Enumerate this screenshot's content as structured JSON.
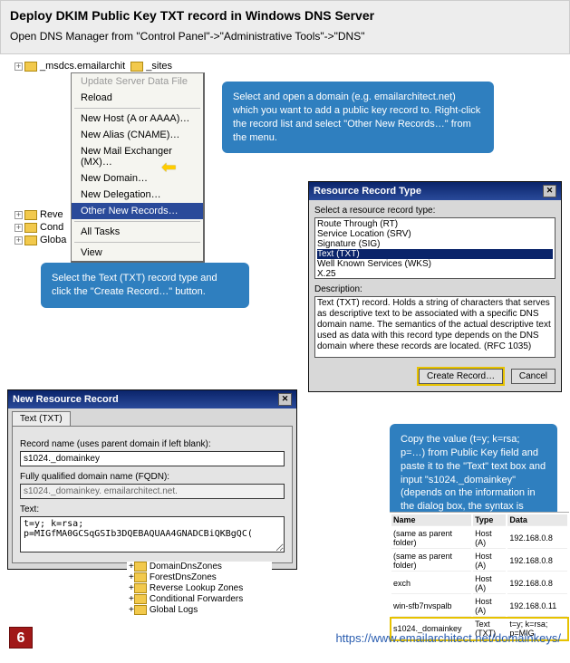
{
  "header": {
    "title": "Deploy DKIM Public Key TXT record in Windows DNS Server",
    "subtitle": "Open DNS Manager from \"Control Panel\"->\"Administrative Tools\"->\"DNS\""
  },
  "tree": {
    "row0": "_msdcs.emailarchit",
    "row0b": "_sites",
    "row5": "Reve",
    "row6": "Cond",
    "row7": "Globa"
  },
  "contextMenu": {
    "disabled": "Update Server Data File",
    "reload": "Reload",
    "newHost": "New Host (A or AAAA)…",
    "newAlias": "New Alias (CNAME)…",
    "newMx": "New Mail Exchanger (MX)…",
    "newDomain": "New Domain…",
    "newDeleg": "New Delegation…",
    "otherNew": "Other New Records…",
    "allTasks": "All Tasks",
    "view": "View"
  },
  "callouts": {
    "c1": "Select and open a domain (e.g. emailarchitect.net) which you want to add a public key record to. Right-click the record list and select \"Other New Records…\" from the menu.",
    "c2": "Select the Text (TXT) record type and click the \"Create Record…\" button.",
    "c3": "Copy the value (t=y; k=rsa; p=…) from Public Key field and paste it to the \"Text\" text box and input \"s1024._domainkey\" (depends on the information in the dialog box, the syntax is [selector]._domainkey) in Record Name. Click the OK button."
  },
  "rrtDialog": {
    "title": "Resource Record Type",
    "selectLabel": "Select a resource record type:",
    "items": [
      "Route Through (RT)",
      "Service Location (SRV)",
      "Signature (SIG)",
      "Text (TXT)",
      "Well Known Services (WKS)",
      "X.25"
    ],
    "descLabel": "Description:",
    "descText": "Text (TXT) record. Holds a string of characters that serves as descriptive text to be associated with a specific DNS domain name. The semantics of the actual descriptive text used as data with this record type depends on the DNS domain where these records are located. (RFC 1035)",
    "create": "Create Record…",
    "cancel": "Cancel"
  },
  "newDialog": {
    "title": "New Resource Record",
    "tab": "Text (TXT)",
    "recordNameLabel": "Record name (uses parent domain if left blank):",
    "recordName": "s1024._domainkey",
    "fqdnLabel": "Fully qualified domain name (FQDN):",
    "fqdn": "s1024._domainkey. emailarchitect.net.",
    "textLabel": "Text:",
    "text": "t=y; k=rsa; p=MIGfMA0GCSqGSIb3DQEBAQUAA4GNADCBiQKBgQC("
  },
  "tree2": {
    "r1": "DomainDnsZones",
    "r2": "ForestDnsZones",
    "r3": "Reverse Lookup Zones",
    "r4": "Conditional Forwarders",
    "r5": "Global Logs"
  },
  "table": {
    "h1": "Name",
    "h2": "Type",
    "h3": "Data",
    "rowA1": "(same as parent folder)",
    "rowA2": "Host (A)",
    "rowA3": "192.168.0.8",
    "rowB1": "(same as parent folder)",
    "rowB2": "Host (A)",
    "rowB3": "192.168.0.8",
    "rowC1": "exch",
    "rowC2": "Host (A)",
    "rowC3": "192.168.0.8",
    "rowD1": "win-sfb7nvspalb",
    "rowD2": "Host (A)",
    "rowD3": "192.168.0.11",
    "rowE1": "s1024._domainkey",
    "rowE2": "Text (TXT)",
    "rowE3": "t=y; k=rsa; p=MIG"
  },
  "footer": {
    "pageNumber": "6",
    "url": "https://www.emailarchitect.net/domainkeys/"
  }
}
